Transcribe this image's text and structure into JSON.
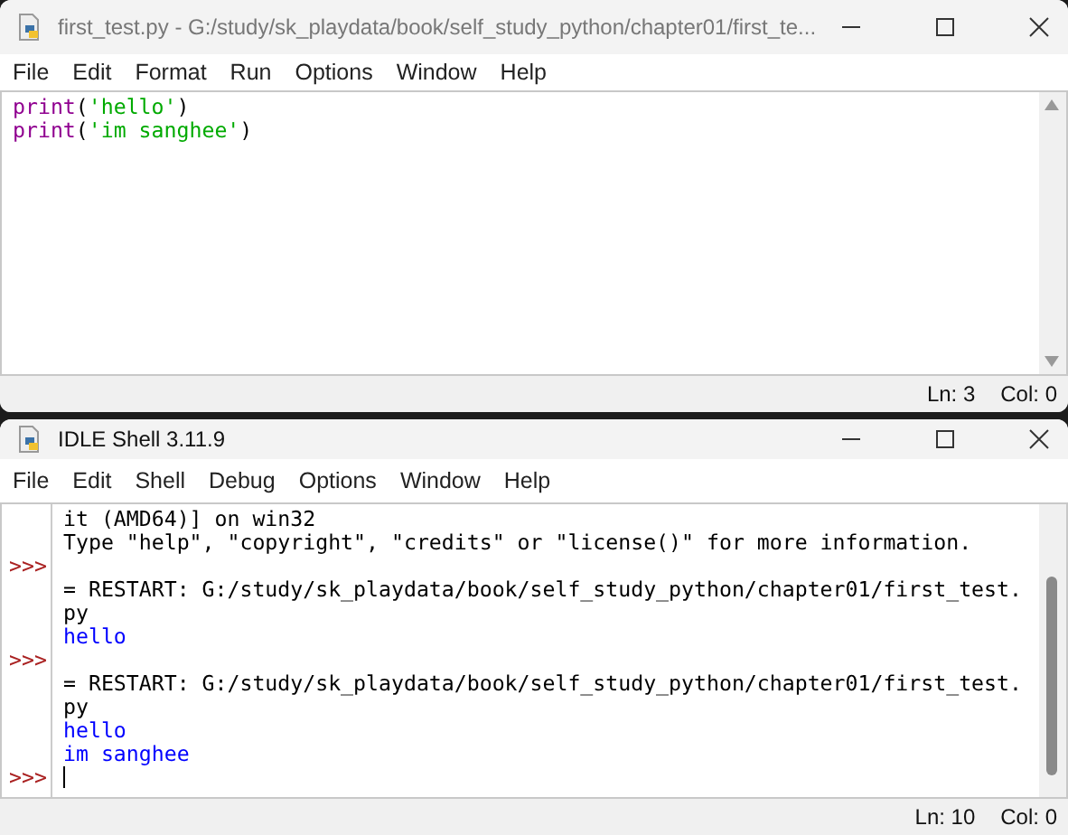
{
  "editor_window": {
    "title": "first_test.py - G:/study/sk_playdata/book/self_study_python/chapter01/first_te...",
    "menu": [
      "File",
      "Edit",
      "Format",
      "Run",
      "Options",
      "Window",
      "Help"
    ],
    "code_lines": [
      [
        {
          "kind": "builtin",
          "text": "print"
        },
        {
          "kind": "plain",
          "text": "("
        },
        {
          "kind": "string",
          "text": "'hello'"
        },
        {
          "kind": "plain",
          "text": ")"
        }
      ],
      [
        {
          "kind": "builtin",
          "text": "print"
        },
        {
          "kind": "plain",
          "text": "("
        },
        {
          "kind": "string",
          "text": "'im sanghee'"
        },
        {
          "kind": "plain",
          "text": ")"
        }
      ]
    ],
    "status_bar": {
      "line": "Ln: 3",
      "column": "Col: 0"
    }
  },
  "shell_window": {
    "title": "IDLE Shell 3.11.9",
    "menu": [
      "File",
      "Edit",
      "Shell",
      "Debug",
      "Options",
      "Window",
      "Help"
    ],
    "lines": [
      {
        "kind": "output",
        "text": "it (AMD64)] on win32"
      },
      {
        "kind": "output",
        "text": "Type \"help\", \"copyright\", \"credits\" or \"license()\" for more information."
      },
      {
        "kind": "prompt",
        "prompt": ">>>"
      },
      {
        "kind": "output",
        "text": "= RESTART: G:/study/sk_playdata/book/self_study_python/chapter01/first_test."
      },
      {
        "kind": "output",
        "text": "py"
      },
      {
        "kind": "stdout",
        "text": "hello"
      },
      {
        "kind": "prompt",
        "prompt": ">>>"
      },
      {
        "kind": "output",
        "text": "= RESTART: G:/study/sk_playdata/book/self_study_python/chapter01/first_test."
      },
      {
        "kind": "output",
        "text": "py"
      },
      {
        "kind": "stdout",
        "text": "hello"
      },
      {
        "kind": "stdout",
        "text": "im sanghee"
      },
      {
        "kind": "prompt",
        "prompt": ">>>",
        "cursor": true
      }
    ],
    "status_bar": {
      "line": "Ln: 10",
      "column": "Col: 0"
    }
  }
}
